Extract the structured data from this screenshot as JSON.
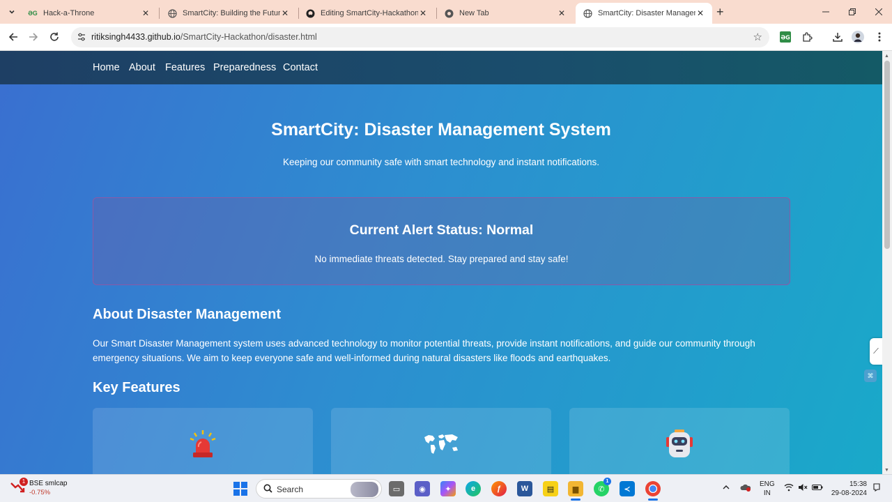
{
  "browser": {
    "tabs": [
      {
        "title": "Hack-a-Throne",
        "favicon": "gg-icon",
        "active": false
      },
      {
        "title": "SmartCity: Building the Future",
        "favicon": "globe-icon",
        "active": false
      },
      {
        "title": "Editing SmartCity-Hackathon/R",
        "favicon": "github-icon",
        "active": false
      },
      {
        "title": "New Tab",
        "favicon": "chrome-icon",
        "active": false
      },
      {
        "title": "SmartCity: Disaster Managemen",
        "favicon": "globe-icon",
        "active": true
      }
    ],
    "url_host": "ritiksingh4433.github.io",
    "url_path": "/SmartCity-Hackathon/disaster.html"
  },
  "site": {
    "nav": [
      "Home",
      "About",
      "Features",
      "Preparedness",
      "Contact"
    ],
    "hero_title": "SmartCity: Disaster Management System",
    "hero_subtitle": "Keeping our community safe with smart technology and instant notifications.",
    "alert_title": "Current Alert Status: Normal",
    "alert_text": "No immediate threats detected. Stay prepared and stay safe!",
    "about_heading": "About Disaster Management",
    "about_text": "Our Smart Disaster Management system uses advanced technology to monitor potential threats, provide instant notifications, and guide our community through emergency situations. We aim to keep everyone safe and well-informed during natural disasters like floods and earthquakes.",
    "features_heading": "Key Features",
    "feature_icons": [
      "siren-icon",
      "world-map-icon",
      "robot-icon"
    ]
  },
  "taskbar": {
    "stock_name": "BSE smlcap",
    "stock_change": "-0.75%",
    "stock_badge": "1",
    "search_placeholder": "Search",
    "whatsapp_badge": "1",
    "lang_line1": "ENG",
    "lang_line2": "IN",
    "time": "15:38",
    "date": "29-08-2024"
  },
  "colors": {
    "tabbar_bg": "#f9dccf",
    "page_gradient_start": "#3a6fd0",
    "page_gradient_end": "#19a9c9",
    "nav_bg": "#1e3f64",
    "alert_border": "#8a5aa8"
  }
}
